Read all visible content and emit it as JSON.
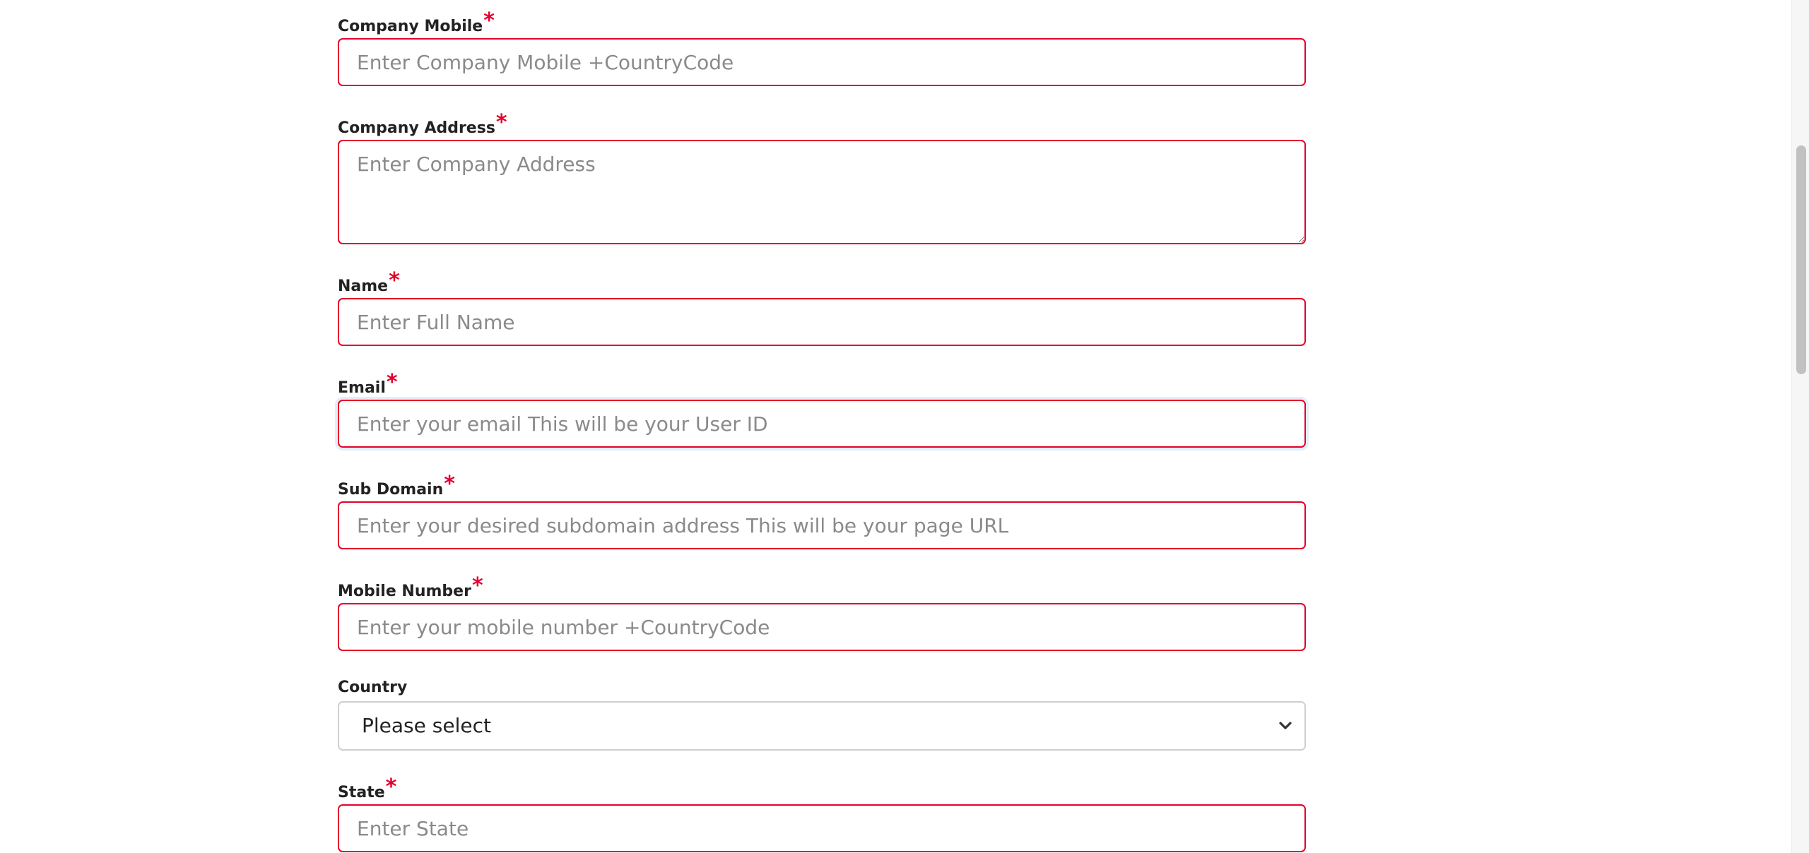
{
  "form": {
    "company_mobile": {
      "label": "Company Mobile",
      "required_mark": "*",
      "placeholder": "Enter Company Mobile +CountryCode",
      "value": ""
    },
    "company_address": {
      "label": "Company Address",
      "required_mark": "*",
      "placeholder": "Enter Company Address",
      "value": ""
    },
    "name": {
      "label": "Name",
      "required_mark": "*",
      "placeholder": "Enter Full Name",
      "value": ""
    },
    "email": {
      "label": "Email",
      "required_mark": "*",
      "placeholder": "Enter your email This will be your User ID",
      "value": ""
    },
    "sub_domain": {
      "label": "Sub Domain",
      "required_mark": "*",
      "placeholder": "Enter your desired subdomain address This will be your page URL",
      "value": ""
    },
    "mobile_number": {
      "label": "Mobile Number",
      "required_mark": "*",
      "placeholder": "Enter your mobile number +CountryCode",
      "value": ""
    },
    "country": {
      "label": "Country",
      "selected": "Please select",
      "icon": "chevron-down-icon"
    },
    "state": {
      "label": "State",
      "required_mark": "*",
      "placeholder": "Enter State",
      "value": ""
    }
  },
  "colors": {
    "error_border": "#e4002b",
    "required_mark": "#e4002b",
    "label_text": "#222222",
    "placeholder_text": "#8a8a8a",
    "select_border": "#cfcfcf",
    "scrollbar_thumb": "#c1c1c1"
  },
  "scrollbar": {
    "position_fraction": 0.26
  }
}
